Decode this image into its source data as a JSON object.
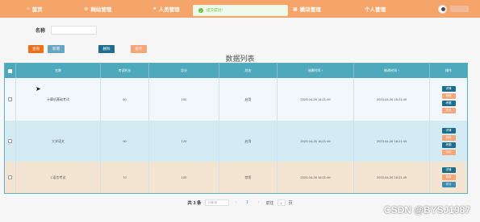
{
  "nav": {
    "items": [
      {
        "label": "首页",
        "icon": "home-icon",
        "glyph": "⌂"
      },
      {
        "label": "网站管理",
        "icon": "settings-icon",
        "glyph": "⚙"
      },
      {
        "label": "人员管理",
        "icon": "user-icon",
        "glyph": "👤"
      },
      {
        "label": "模块管理",
        "icon": "grid-icon",
        "glyph": "▦"
      },
      {
        "label": "个人管理",
        "icon": "person-icon",
        "glyph": ""
      }
    ],
    "user_name": "admin"
  },
  "toast": {
    "message": "提交成功！"
  },
  "search": {
    "label": "名称",
    "value": "",
    "placeholder": ""
  },
  "buttons": {
    "search": "查询",
    "add": "新增",
    "delete": "删除",
    "stat": "统计"
  },
  "list_title": "数据列表",
  "table": {
    "headers": [
      "名称",
      "考试时长",
      "总分",
      "状态",
      "创建时间 ↑",
      "修改时间 ↑",
      "操作"
    ],
    "rows": [
      {
        "name": "计算机基础考试",
        "duration": "60",
        "score": "100",
        "status": "启用",
        "created": "2023-04-26 16:21:49",
        "updated": "2023-04-26 16:21:49",
        "ops": [
          "详情",
          "修改",
          "考题",
          "评分"
        ]
      },
      {
        "name": "大学语文",
        "duration": "90",
        "score": "120",
        "status": "启用",
        "created": "2023-04-26 16:21:49",
        "updated": "2023-04-26 16:21:49",
        "ops": [
          "详情",
          "修改",
          "考题",
          "评分"
        ]
      },
      {
        "name": "C语言考试",
        "duration": "70",
        "score": "100",
        "status": "禁用",
        "created": "2023-04-26 16:21:49",
        "updated": "2023-04-26 16:21:49",
        "ops": [
          "详情",
          "修改",
          "评分"
        ]
      }
    ],
    "row_colors": [
      "#f1f7fb",
      "#d4ebf4",
      "#f4e5d3"
    ]
  },
  "pager": {
    "total": "共 3 条",
    "page_size": "10条/页",
    "prev": "‹",
    "page": "1",
    "next": "›",
    "goto_label": "前往",
    "goto_value": "1",
    "page_unit": "页"
  },
  "watermark": "CSDN @BYSJ1987"
}
